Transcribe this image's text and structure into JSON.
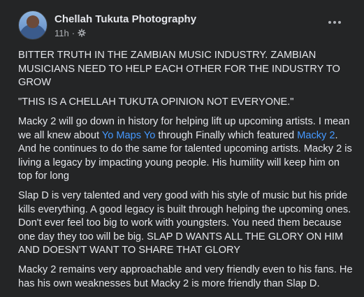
{
  "post": {
    "author": "Chellah Tukuta Photography",
    "time": "11h",
    "separator": "·",
    "privacy_icon": "settings-gear-icon",
    "more_icon": "more-options-icon"
  },
  "paragraphs": {
    "p1": "BITTER TRUTH IN THE ZAMBIAN MUSIC INDUSTRY. ZAMBIAN MUSICIANS NEED TO HELP EACH OTHER FOR THE INDUSTRY TO GROW",
    "p2": "\"THIS IS A CHELLAH TUKUTA OPINION NOT EVERYONE.\"",
    "p3": {
      "before_link1": "Macky 2 will go down in history for helping lift up upcoming artists. I mean we all knew about ",
      "link1": "Yo Maps Yo",
      "between": " through Finally which featured ",
      "link2": "Macky 2",
      "after": ". And he continues to do the same for talented upcoming artists. Macky 2 is living a legacy by impacting young people. His humility will keep him on top for long"
    },
    "p4": "Slap D is very talented and very good with his style of music but his pride kills everything. A good legacy is built through helping the upcoming ones. Don't ever feel too big to work with youngsters. You need them because one day they too will be big. SLAP D WANTS ALL THE GLORY ON HIM AND DOESN'T WANT TO SHARE THAT GLORY",
    "p5": "Macky 2 remains very approachable and very friendly even to his fans. He has his own weaknesses but Macky 2 is more friendly than Slap D."
  },
  "colors": {
    "background": "#242526",
    "text": "#e4e6eb",
    "secondary": "#b0b3b8",
    "link": "#4599ff"
  }
}
